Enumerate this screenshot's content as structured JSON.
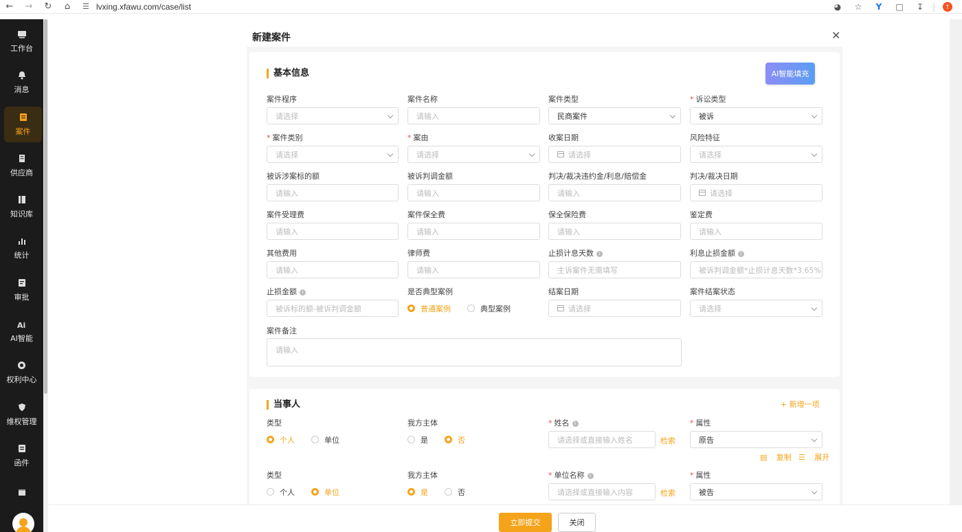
{
  "browser": {
    "url": "lvxing.xfawu.com/case/list",
    "profile_initial": "T"
  },
  "sidebar": {
    "items": [
      {
        "label": "工作台",
        "icon": "dashboard-icon"
      },
      {
        "label": "消息",
        "icon": "bell-icon"
      },
      {
        "label": "案件",
        "icon": "case-icon"
      },
      {
        "label": "供应商",
        "icon": "building-icon"
      },
      {
        "label": "知识库",
        "icon": "book-icon"
      },
      {
        "label": "统计",
        "icon": "bar-chart-icon"
      },
      {
        "label": "审批",
        "icon": "approval-icon"
      },
      {
        "label": "AI智能",
        "icon": "ai-icon"
      },
      {
        "label": "权利中心",
        "icon": "rights-icon"
      },
      {
        "label": "维权管理",
        "icon": "shield-icon"
      },
      {
        "label": "函件",
        "icon": "letter-icon"
      }
    ],
    "active_index": 2
  },
  "modal": {
    "title": "新建案件",
    "basic": {
      "title": "基本信息",
      "ai_button": "AI智能填充",
      "fields": [
        {
          "label": "案件程序",
          "required": false,
          "value": "请选择",
          "filled": false,
          "kind": "select"
        },
        {
          "label": "案件名称",
          "required": false,
          "value": "请输入",
          "filled": false,
          "kind": "input"
        },
        {
          "label": "案件类型",
          "required": false,
          "value": "民商案件",
          "filled": true,
          "kind": "select"
        },
        {
          "label": "诉讼类型",
          "required": true,
          "value": "被诉",
          "filled": true,
          "kind": "select"
        },
        {
          "label": "案件类别",
          "required": true,
          "value": "请选择",
          "filled": false,
          "kind": "select"
        },
        {
          "label": "案由",
          "required": true,
          "value": "请选择",
          "filled": false,
          "kind": "select"
        },
        {
          "label": "收案日期",
          "required": false,
          "value": "请选择",
          "filled": false,
          "kind": "date"
        },
        {
          "label": "风险特征",
          "required": false,
          "value": "请选择",
          "filled": false,
          "kind": "select"
        },
        {
          "label": "被诉涉案标的额",
          "required": false,
          "value": "请输入",
          "filled": false,
          "kind": "input"
        },
        {
          "label": "被诉判调金额",
          "required": false,
          "value": "请输入",
          "filled": false,
          "kind": "input"
        },
        {
          "label": "判决/裁决违约金/利息/赔偿金",
          "required": false,
          "value": "请输入",
          "filled": false,
          "kind": "input"
        },
        {
          "label": "判决/裁决日期",
          "required": false,
          "value": "请选择",
          "filled": false,
          "kind": "date"
        },
        {
          "label": "案件受理费",
          "required": false,
          "value": "请输入",
          "filled": false,
          "kind": "input"
        },
        {
          "label": "案件保全费",
          "required": false,
          "value": "请输入",
          "filled": false,
          "kind": "input"
        },
        {
          "label": "保全保险费",
          "required": false,
          "value": "请输入",
          "filled": false,
          "kind": "input"
        },
        {
          "label": "鉴定费",
          "required": false,
          "value": "请输入",
          "filled": false,
          "kind": "input"
        },
        {
          "label": "其他费用",
          "required": false,
          "value": "请输入",
          "filled": false,
          "kind": "input"
        },
        {
          "label": "律师费",
          "required": false,
          "value": "请输入",
          "filled": false,
          "kind": "input"
        },
        {
          "label": "止损计息天数",
          "required": false,
          "value": "主诉案件无需填写",
          "filled": false,
          "kind": "input",
          "info": true
        },
        {
          "label": "利息止损金额",
          "required": false,
          "value": "被诉判调金额*止损计息天数*3.65%",
          "filled": false,
          "kind": "input",
          "info": true
        },
        {
          "label": "止损金额",
          "required": false,
          "value": "被诉标的额-被诉判调金额",
          "filled": false,
          "kind": "input",
          "info": true
        },
        {
          "label": "是否典型案例",
          "required": false,
          "kind": "radio",
          "options": [
            "普通案例",
            "典型案例"
          ],
          "selected": 0
        },
        {
          "label": "结案日期",
          "required": false,
          "value": "请选择",
          "filled": false,
          "kind": "date"
        },
        {
          "label": "案件结案状态",
          "required": false,
          "value": "请选择",
          "filled": false,
          "kind": "select"
        }
      ],
      "remark": {
        "label": "案件备注",
        "placeholder": "请输入"
      }
    },
    "parties": {
      "title": "当事人",
      "add_label": "+ 新增一项",
      "rows": [
        {
          "type_label": "类型",
          "type_options": [
            "个人",
            "单位"
          ],
          "type_selected": 0,
          "side_label": "我方主体",
          "side_options": [
            "是",
            "否"
          ],
          "side_selected": 1,
          "name_label": "姓名",
          "name_placeholder": "请选择或直接输入姓名",
          "search_label": "检索",
          "attr_label": "属性",
          "attr_value": "原告",
          "copy_label": "复制",
          "expand_label": "展开"
        },
        {
          "type_label": "类型",
          "type_options": [
            "个人",
            "单位"
          ],
          "type_selected": 1,
          "side_label": "我方主体",
          "side_options": [
            "是",
            "否"
          ],
          "side_selected": 0,
          "name_label": "单位名称",
          "name_placeholder": "请选择或直接输入内容",
          "search_label": "检索",
          "attr_label": "属性",
          "attr_value": "被告"
        }
      ]
    },
    "footer": {
      "submit_label": "立即提交",
      "close_label": "关闭"
    }
  }
}
